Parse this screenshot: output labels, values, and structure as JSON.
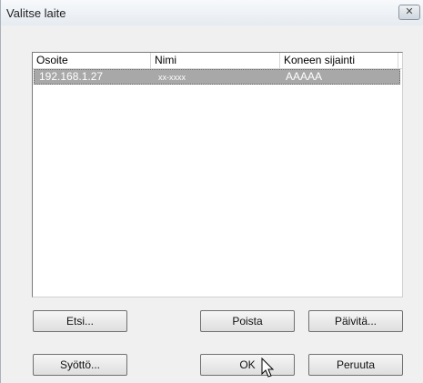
{
  "window": {
    "title": "Valitse laite",
    "close_glyph": "✕"
  },
  "table": {
    "columns": [
      "Osoite",
      "Nimi",
      "Koneen sijainti"
    ],
    "rows": [
      {
        "address": "192.168.1.27",
        "name": "xx-xxxx",
        "location": "AAAAA"
      }
    ]
  },
  "buttons": {
    "search": "Etsi...",
    "delete": "Poista",
    "refresh": "Päivitä...",
    "input": "Syöttö...",
    "ok": "OK",
    "cancel": "Peruuta"
  }
}
